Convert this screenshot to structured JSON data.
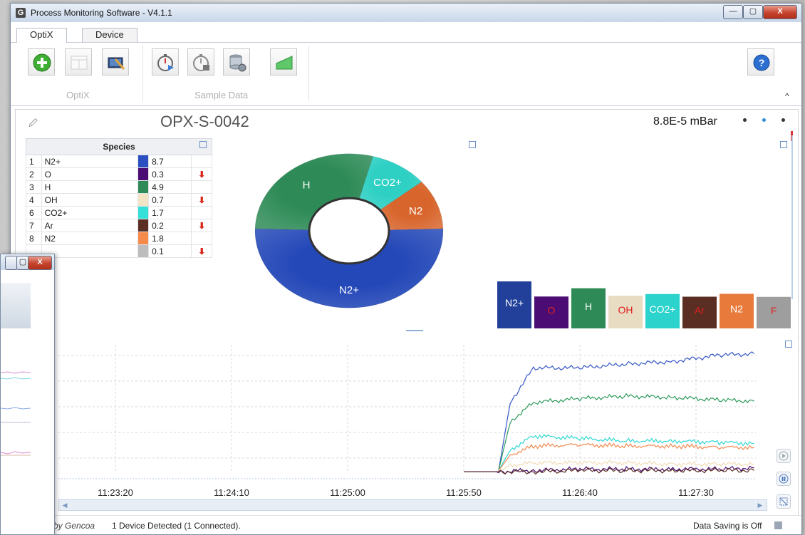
{
  "window": {
    "title": "Process Monitoring Software - V4.1.1",
    "icon_letter": "G",
    "minimize_glyph": "—",
    "maximize_glyph": "▢",
    "close_glyph": "X"
  },
  "tabs": [
    {
      "label": "OptiX",
      "active": true
    },
    {
      "label": "Device",
      "active": false
    }
  ],
  "ribbon": {
    "groups": [
      {
        "label": "OptiX",
        "buttons": [
          "add-icon",
          "blank-panel-icon",
          "monitor-tools-icon"
        ]
      },
      {
        "label": "Sample Data",
        "buttons": [
          "stopwatch-play-icon",
          "stopwatch-stop-icon",
          "database-settings-icon",
          "green-area-chart-icon"
        ]
      }
    ],
    "help_icon": "help-icon",
    "collapse_glyph": "^"
  },
  "device": {
    "name": "OPX-S-0042",
    "pressure": "8.8E-5  mBar"
  },
  "species_table": {
    "header": "Species",
    "rows": [
      {
        "idx": "1",
        "name": "N2+",
        "color": "#2b4fc0",
        "value": "8.7",
        "arrow": ""
      },
      {
        "idx": "2",
        "name": "O",
        "color": "#4b0d73",
        "value": "0.3",
        "arrow": "down"
      },
      {
        "idx": "3",
        "name": "H",
        "color": "#2e8b57",
        "value": "4.9",
        "arrow": ""
      },
      {
        "idx": "4",
        "name": "OH",
        "color": "#f3e4c6",
        "value": "0.7",
        "arrow": "down"
      },
      {
        "idx": "6",
        "name": "CO2+",
        "color": "#34e0d8",
        "value": "1.7",
        "arrow": ""
      },
      {
        "idx": "7",
        "name": "Ar",
        "color": "#5a2e22",
        "value": "0.2",
        "arrow": "down"
      },
      {
        "idx": "8",
        "name": "N2",
        "color": "#f58a4b",
        "value": "1.8",
        "arrow": ""
      },
      {
        "idx": "",
        "name": "",
        "color": "#bdbdbd",
        "value": "0.1",
        "arrow": "down"
      }
    ]
  },
  "donut": {
    "segments": [
      {
        "label": "N2+",
        "value": 8.7,
        "color": "#2448b8"
      },
      {
        "label": "H",
        "value": 4.9,
        "color": "#2e8b57"
      },
      {
        "label": "CO2+",
        "value": 1.7,
        "color": "#2fd0c4"
      },
      {
        "label": "N2",
        "value": 1.8,
        "color": "#d8652c"
      }
    ]
  },
  "bar_legend": [
    {
      "label": "N2+",
      "color": "#22409a",
      "text_color": "#ffffff",
      "value": 8.7
    },
    {
      "label": "O",
      "color": "#4b0d73",
      "text_color": "#e02020",
      "value": 0.3
    },
    {
      "label": "H",
      "color": "#2e8b57",
      "text_color": "#ffffff",
      "value": 4.9
    },
    {
      "label": "OH",
      "color": "#e8dcc2",
      "text_color": "#e02020",
      "value": 0.7
    },
    {
      "label": "CO2+",
      "color": "#2cd2cc",
      "text_color": "#ffffff",
      "value": 1.7
    },
    {
      "label": "Ar",
      "color": "#5a2e22",
      "text_color": "#e02020",
      "value": 0.2
    },
    {
      "label": "N2",
      "color": "#e87a3c",
      "text_color": "#ffffff",
      "value": 1.8
    },
    {
      "label": "F",
      "color": "#9e9e9e",
      "text_color": "#e02020",
      "value": 0.1
    }
  ],
  "chart_data": {
    "type": "line",
    "x_ticks": [
      "11:23:20",
      "11:24:10",
      "11:25:00",
      "11:25:50",
      "11:26:40",
      "11:27:30"
    ],
    "grid": true,
    "series": [
      {
        "color": "#3556c4",
        "x": [
          "11:26:05",
          "11:26:10",
          "11:26:20",
          "11:26:40",
          "11:27:00",
          "11:27:20",
          "11:27:40",
          "11:27:55"
        ],
        "y": [
          0.02,
          0.55,
          0.82,
          0.82,
          0.85,
          0.87,
          0.92,
          0.93
        ]
      },
      {
        "color": "#2e9a5c",
        "x": [
          "11:26:05",
          "11:26:10",
          "11:26:20",
          "11:26:40",
          "11:27:00",
          "11:27:20",
          "11:27:40",
          "11:27:55"
        ],
        "y": [
          0.02,
          0.4,
          0.55,
          0.58,
          0.6,
          0.59,
          0.57,
          0.56
        ]
      },
      {
        "color": "#2fd8d0",
        "x": [
          "11:26:05",
          "11:26:10",
          "11:26:20",
          "11:26:40",
          "11:27:00",
          "11:27:20",
          "11:27:40",
          "11:27:55"
        ],
        "y": [
          0.02,
          0.18,
          0.29,
          0.27,
          0.25,
          0.25,
          0.24,
          0.23
        ]
      },
      {
        "color": "#f08a4f",
        "x": [
          "11:26:05",
          "11:26:10",
          "11:26:20",
          "11:26:40",
          "11:27:00",
          "11:27:20",
          "11:27:40",
          "11:27:55"
        ],
        "y": [
          0.02,
          0.14,
          0.21,
          0.22,
          0.21,
          0.21,
          0.2,
          0.2
        ]
      },
      {
        "color": "#f0dcb6",
        "x": [
          "11:26:05",
          "11:26:10",
          "11:26:20",
          "11:26:40",
          "11:27:00",
          "11:27:20",
          "11:27:40",
          "11:27:55"
        ],
        "y": [
          0.01,
          0.06,
          0.08,
          0.08,
          0.08,
          0.07,
          0.07,
          0.07
        ]
      },
      {
        "color": "#4b0d73",
        "x": [
          "11:25:50",
          "11:26:05",
          "11:26:20",
          "11:26:40",
          "11:27:00",
          "11:27:20",
          "11:27:40",
          "11:27:55"
        ],
        "y": [
          0.01,
          0.01,
          0.02,
          0.03,
          0.03,
          0.03,
          0.03,
          0.04
        ]
      },
      {
        "color": "#5a2e22",
        "x": [
          "11:25:50",
          "11:26:05",
          "11:26:20",
          "11:26:40",
          "11:27:00",
          "11:27:20",
          "11:27:40",
          "11:27:55"
        ],
        "y": [
          0.01,
          0.01,
          0.01,
          0.02,
          0.02,
          0.02,
          0.02,
          0.02
        ]
      }
    ]
  },
  "status": {
    "by": "by Gencoa",
    "devices": "1 Device Detected (1 Connected).",
    "saving": "Data Saving is Off"
  }
}
